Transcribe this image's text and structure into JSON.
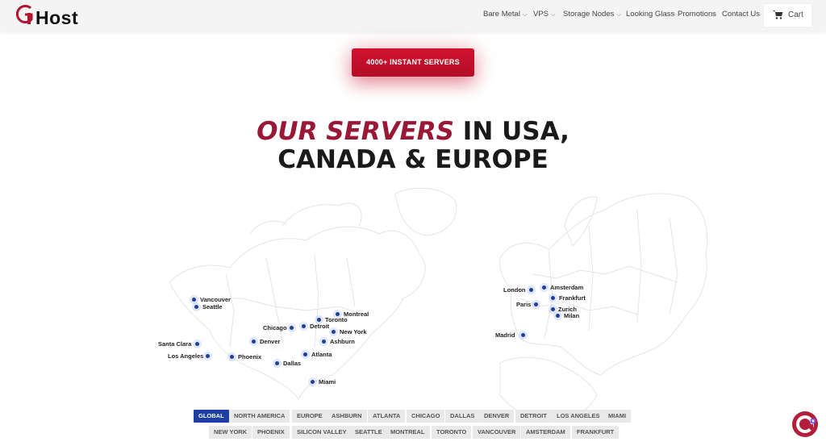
{
  "header": {
    "brand": "Host",
    "nav": [
      {
        "label": "Bare Metal",
        "dropdown": true
      },
      {
        "label": "VPS",
        "dropdown": true
      },
      {
        "label": "Storage Nodes",
        "dropdown": true
      },
      {
        "label": "Looking Glass",
        "dropdown": false
      },
      {
        "label": "Promotions",
        "dropdown": false
      },
      {
        "label": "Contact Us",
        "dropdown": false
      }
    ],
    "cart_label": "Cart"
  },
  "cta_label": "4000+ INSTANT SERVERS",
  "headline": {
    "accent": "OUR SERVERS",
    "rest_line1": " IN USA,",
    "line2": "CANADA & EUROPE"
  },
  "map": {
    "locations": [
      "Vancouver",
      "Seattle",
      "Montreal",
      "Toronto",
      "Detroit",
      "Chicago",
      "New York",
      "Denver",
      "Ashburn",
      "Santa Clara",
      "Los Angeles",
      "Phoenix",
      "Atlanta",
      "Dallas",
      "Miami",
      "London",
      "Amsterdam",
      "Paris",
      "Frankfurt",
      "Zurich",
      "Milan",
      "Madrid"
    ]
  },
  "filters": {
    "row1": [
      "GLOBAL",
      "NORTH AMERICA",
      "EUROPE",
      "ASHBURN",
      "ATLANTA",
      "CHICAGO",
      "DALLAS",
      "DENVER",
      "DETROIT",
      "LOS ANGELES",
      "MIAMI"
    ],
    "row2": [
      "NEW YORK",
      "PHOENIX",
      "SILICON VALLEY",
      "SEATTLE",
      "MONTREAL",
      "TORONTO",
      "VANCOUVER",
      "AMSTERDAM",
      "FRANKFURT"
    ],
    "active": "GLOBAL"
  },
  "colors": {
    "accent_red": "#c8102e",
    "headline_accent": "#9a1736",
    "active_tab": "#1d3fa3",
    "pin": "#1f3f9c"
  }
}
